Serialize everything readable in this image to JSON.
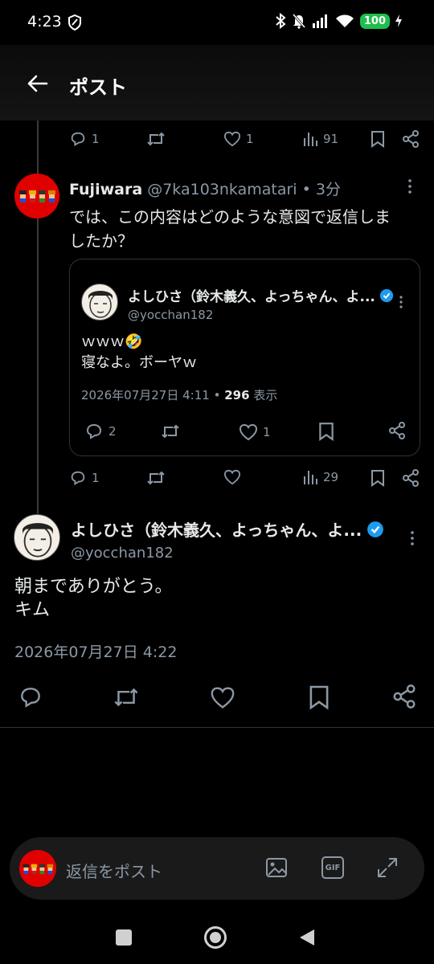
{
  "status": {
    "time": "4:23",
    "battery": "100"
  },
  "header": {
    "title": "ポスト"
  },
  "parent_actions": {
    "replies": "1",
    "likes": "1",
    "views": "91"
  },
  "reply_post": {
    "author_name": "Fujiwara",
    "author_handle": "@7ka103nkamatari",
    "time_sep": "•",
    "time_ago": "3分",
    "text_line1": "では、この内容はどのような意図で返信しま",
    "text_line2": "したか？",
    "quote": {
      "author_name": "よしひさ（鈴木義久、よっちゃん、よ...",
      "author_handle": "@yocchan182",
      "text_line1": "ｗｗｗ🤣",
      "text_line2": "寝なよ。ボーヤｗ",
      "date": "2026年07月27日 4:11",
      "dot": "•",
      "views_count": "296",
      "views_label": "表示",
      "replies": "2",
      "likes": "1"
    },
    "actions": {
      "replies": "1",
      "views": "29"
    }
  },
  "main_post": {
    "author_name": "よしひさ（鈴木義久、よっちゃん、よ...",
    "author_handle": "@yocchan182",
    "text_line1": "朝までありがとう。",
    "text_line2": "キム",
    "date": "2026年07月27日 4:22"
  },
  "reply_bar": {
    "placeholder": "返信をポスト",
    "gif_label": "GIF"
  },
  "colors": {
    "verified": "#1d9bf0",
    "muted": "#8b98a5",
    "battery": "#1fbe4d"
  }
}
